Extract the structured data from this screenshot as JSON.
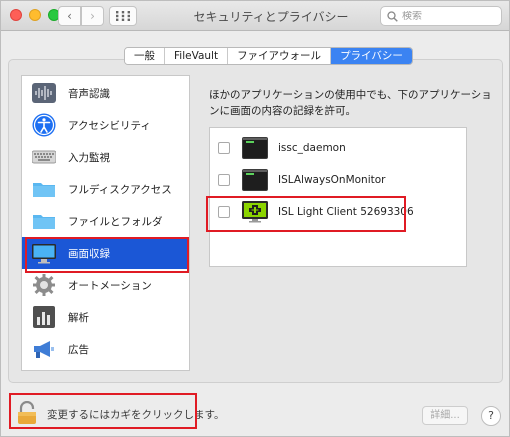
{
  "window": {
    "title": "セキュリティとプライバシー",
    "nav_back": "‹",
    "nav_forward": "›"
  },
  "search": {
    "placeholder": "検索"
  },
  "tabs": [
    {
      "label": "一般",
      "active": false
    },
    {
      "label": "FileVault",
      "active": false
    },
    {
      "label": "ファイアウォール",
      "active": false
    },
    {
      "label": "プライバシー",
      "active": true
    }
  ],
  "sidebar": {
    "items": [
      {
        "label": "音声認識",
        "icon": "waveform-icon",
        "selected": false
      },
      {
        "label": "アクセシビリティ",
        "icon": "accessibility-icon",
        "selected": false
      },
      {
        "label": "入力監視",
        "icon": "keyboard-icon",
        "selected": false
      },
      {
        "label": "フルディスクアクセス",
        "icon": "folder-icon",
        "selected": false
      },
      {
        "label": "ファイルとフォルダ",
        "icon": "folder-icon",
        "selected": false
      },
      {
        "label": "画面収録",
        "icon": "display-icon",
        "selected": true
      },
      {
        "label": "オートメーション",
        "icon": "gear-icon",
        "selected": false
      },
      {
        "label": "解析",
        "icon": "analytics-icon",
        "selected": false
      },
      {
        "label": "広告",
        "icon": "megaphone-icon",
        "selected": false
      }
    ]
  },
  "panel": {
    "description": "ほかのアプリケーションの使用中でも、下のアプリケーションに画面の内容の記録を許可。",
    "apps": [
      {
        "name": "issc_daemon",
        "icon": "terminal-icon",
        "checked": false
      },
      {
        "name": "ISLAlwaysOnMonitor",
        "icon": "terminal-icon",
        "checked": false
      },
      {
        "name": "ISL Light Client 52693306",
        "icon": "isl-light-icon",
        "checked": false
      }
    ]
  },
  "footer": {
    "lock_text": "変更するにはカギをクリックします。",
    "details_label": "詳細...",
    "help_label": "?"
  },
  "colors": {
    "accent": "#3b83f2",
    "selection": "#1b57d6",
    "highlight": "#e01b24"
  }
}
